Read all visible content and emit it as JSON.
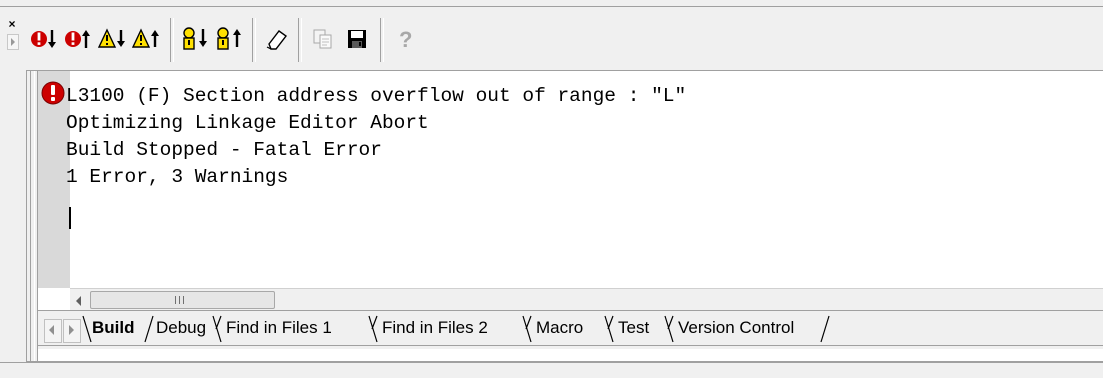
{
  "toolbar": {
    "buttons": [
      {
        "name": "next-error-button",
        "icon": "error-down-icon"
      },
      {
        "name": "previous-error-button",
        "icon": "error-up-icon"
      },
      {
        "name": "next-warning-button",
        "icon": "warning-down-icon"
      },
      {
        "name": "previous-warning-button",
        "icon": "warning-up-icon"
      },
      {
        "name": "next-tagged-button",
        "icon": "tag-down-icon"
      },
      {
        "name": "previous-tagged-button",
        "icon": "tag-up-icon"
      },
      {
        "name": "clear-button",
        "icon": "eraser-icon"
      },
      {
        "name": "copy-button",
        "icon": "copy-icon"
      },
      {
        "name": "save-button",
        "icon": "floppy-disk-icon"
      },
      {
        "name": "help-button",
        "icon": "question-icon"
      }
    ]
  },
  "output": {
    "lines": [
      "L3100 (F) Section address overflow out of range : \"L\"",
      "Optimizing Linkage Editor Abort",
      "Build Stopped - Fatal Error",
      "1 Error, 3 Warnings"
    ],
    "marker_icon": "error-marker-icon"
  },
  "tabs": [
    {
      "label": "Build",
      "active": true
    },
    {
      "label": "Debug",
      "active": false
    },
    {
      "label": "Find in Files 1",
      "active": false
    },
    {
      "label": "Find in Files 2",
      "active": false
    },
    {
      "label": "Macro",
      "active": false
    },
    {
      "label": "Test",
      "active": false
    },
    {
      "label": "Version Control",
      "active": false
    }
  ],
  "colors": {
    "error_red": "#cc0000",
    "warning_yellow": "#ffe000",
    "gutter_gray": "#d9d9d9"
  }
}
